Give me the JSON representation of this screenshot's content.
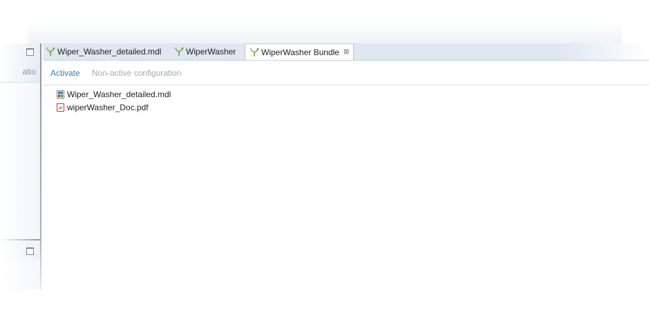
{
  "left_panel": {
    "sub_label": "atio"
  },
  "editor": {
    "tabs": [
      {
        "label": "Wiper_Washer_detailed.mdl",
        "icon": "bundle-icon",
        "active": false
      },
      {
        "label": "WiperWasher",
        "icon": "bundle-icon",
        "active": false
      },
      {
        "label": "WiperWasher Bundle",
        "icon": "bundle-icon",
        "active": true,
        "close": "⊠"
      }
    ],
    "toolbar": {
      "activate_label": "Activate",
      "config_label": "Non-active configuration"
    },
    "files": [
      {
        "name": "Wiper_Washer_detailed.mdl",
        "icon": "mdl-file-icon"
      },
      {
        "name": "wiperWasher_Doc.pdf",
        "icon": "pdf-file-icon"
      }
    ]
  },
  "colors": {
    "link": "#2a7fbf",
    "disabled": "#a2a8b0",
    "tabbar": "#dfe7f1",
    "pdf": "#d93025",
    "bundle_green": "#6a8f2b"
  }
}
